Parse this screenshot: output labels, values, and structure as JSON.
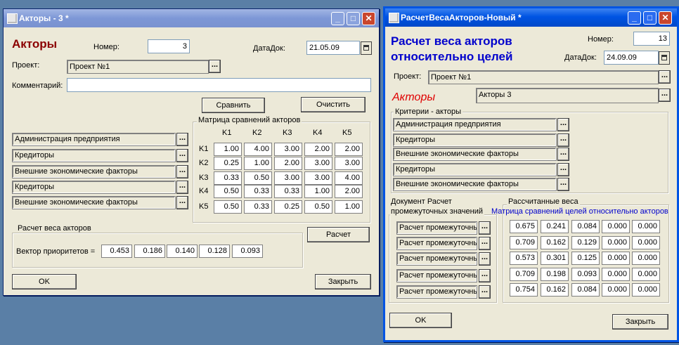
{
  "win1": {
    "title": "Акторы - 3 *",
    "heading": "Акторы",
    "nomer_label": "Номер:",
    "nomer_value": "3",
    "datadoc_label": "ДатаДок:",
    "datadoc_value": "21.05.09",
    "project_label": "Проект:",
    "project_value": "Проект №1",
    "comment_label": "Комментарий:",
    "comment_value": "",
    "compare_button": "Сравнить",
    "clear_button": "Очистить",
    "matrix_title": "Матрица сравнений акторов",
    "col_headers": [
      "K1",
      "K2",
      "K3",
      "K4",
      "K5"
    ],
    "row_headers": [
      "K1",
      "K2",
      "K3",
      "K4",
      "K5"
    ],
    "matrix": [
      [
        "1.00",
        "4.00",
        "3.00",
        "2.00",
        "2.00"
      ],
      [
        "0.25",
        "1.00",
        "2.00",
        "3.00",
        "3.00"
      ],
      [
        "0.33",
        "0.50",
        "3.00",
        "3.00",
        "4.00"
      ],
      [
        "0.50",
        "0.33",
        "0.33",
        "1.00",
        "2.00"
      ],
      [
        "0.50",
        "0.33",
        "0.25",
        "0.50",
        "1.00"
      ]
    ],
    "actors": [
      "Администрация предприятия",
      "Кредиторы",
      "Внешние экономические факторы",
      "Кредиторы",
      "Внешние экономические факторы"
    ],
    "weights_group_title": "Расчет веса акторов",
    "priority_label": "Вектор приоритетов =",
    "priority_values": [
      "0.453",
      "0.186",
      "0.140",
      "0.128",
      "0.093"
    ],
    "calc_button": "Расчет",
    "ok_button": "OK",
    "close_button": "Закрыть"
  },
  "win2": {
    "title": "РасчетВесаАкторов-Новый *",
    "heading_line1": "Расчет веса акторов",
    "heading_line2": "относительно целей",
    "nomer_label": "Номер:",
    "nomer_value": "13",
    "datadoc_label": "ДатаДок:",
    "datadoc_value": "24.09.09",
    "project_label": "Проект:",
    "project_value": "Проект №1",
    "actors_label": "Акторы",
    "actors_value": "Акторы 3",
    "criteria_group_title": "Критерии - акторы",
    "criteria": [
      "Администрация предприятия",
      "Кредиторы",
      "Внешние экономические факторы",
      "Кредиторы",
      "Внешние экономические факторы"
    ],
    "doc_group_title_line1": "Документ Расчет",
    "doc_group_title_line2": "промежуточных значений",
    "doc_items": [
      "Расчет промежуточны",
      "Расчет промежуточны",
      "Расчет промежуточны",
      "Расчет промежуточны",
      "Расчет промежуточны"
    ],
    "weights_group_title": "Рассчитанные веса",
    "weights_matrix_title": "Матрица сравнений целей относительно акторов",
    "weights": [
      [
        "0.675",
        "0.241",
        "0.084",
        "0.000",
        "0.000"
      ],
      [
        "0.709",
        "0.162",
        "0.129",
        "0.000",
        "0.000"
      ],
      [
        "0.573",
        "0.301",
        "0.125",
        "0.000",
        "0.000"
      ],
      [
        "0.709",
        "0.198",
        "0.093",
        "0.000",
        "0.000"
      ],
      [
        "0.754",
        "0.162",
        "0.084",
        "0.000",
        "0.000"
      ]
    ],
    "ok_button": "OK",
    "close_button": "Закрыть"
  },
  "colors": {
    "heading1": "#8b0000",
    "heading2": "#0000cc",
    "actors_label": "#e00000",
    "matrix_title2": "#0000cc"
  }
}
